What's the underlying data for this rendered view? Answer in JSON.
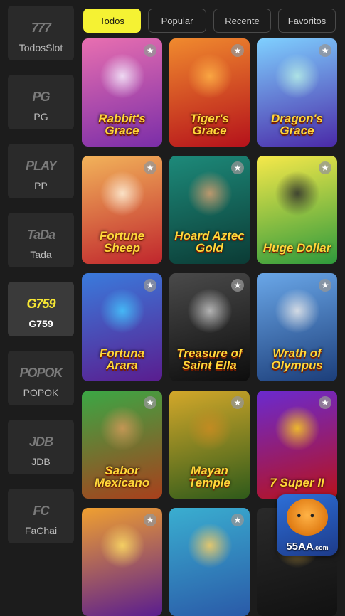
{
  "sidebar": {
    "items": [
      {
        "label": "TodosSlot",
        "logo": "777"
      },
      {
        "label": "PG",
        "logo": "PG"
      },
      {
        "label": "PP",
        "logo": "PLAY"
      },
      {
        "label": "Tada",
        "logo": "TaDa"
      },
      {
        "label": "G759",
        "logo": "G759"
      },
      {
        "label": "POPOK",
        "logo": "POPOK"
      },
      {
        "label": "JDB",
        "logo": "JDB"
      },
      {
        "label": "FaChai",
        "logo": "FC"
      }
    ],
    "active": "G759"
  },
  "tabs": [
    {
      "label": "Todos"
    },
    {
      "label": "Popular"
    },
    {
      "label": "Recente"
    },
    {
      "label": "Favoritos"
    }
  ],
  "games": [
    {
      "title": "Rabbit's Grace",
      "bg1": "#e86fb0",
      "bg2": "#7b2ea8",
      "art": "#f6f0ff"
    },
    {
      "title": "Tiger's Grace",
      "bg1": "#f08a2e",
      "bg2": "#b5121b",
      "art": "#ffb347"
    },
    {
      "title": "Dragon's Grace",
      "bg1": "#7fd0ff",
      "bg2": "#4a2aa8",
      "art": "#b8f0e6"
    },
    {
      "title": "Fortune Sheep",
      "bg1": "#f2b35a",
      "bg2": "#c0262d",
      "art": "#fff3dc"
    },
    {
      "title": "Hoard Aztec Gold",
      "bg1": "#1d8a7a",
      "bg2": "#0b3b35",
      "art": "#d8a070"
    },
    {
      "title": "Huge Dollar",
      "bg1": "#f7e94a",
      "bg2": "#2e9a3c",
      "art": "#2d2d2d"
    },
    {
      "title": "Fortuna Arara",
      "bg1": "#3a7bdc",
      "bg2": "#5a1d8f",
      "art": "#45c8ff"
    },
    {
      "title": "Treasure of Saint Ella",
      "bg1": "#4a4a4a",
      "bg2": "#0d0d0d",
      "art": "#c9c9c9"
    },
    {
      "title": "Wrath of Olympus",
      "bg1": "#6aa7e8",
      "bg2": "#1c3e7a",
      "art": "#eaeaea"
    },
    {
      "title": "Sabor Mexicano",
      "bg1": "#3aa845",
      "bg2": "#a8401c",
      "art": "#d59a5a"
    },
    {
      "title": "Mayan Temple",
      "bg1": "#d4a82a",
      "bg2": "#2f5a1a",
      "art": "#c98b22"
    },
    {
      "title": "7 Super II",
      "bg1": "#6a2ad0",
      "bg2": "#b8121c",
      "art": "#ffd21c"
    },
    {
      "title": "",
      "bg1": "#f0a030",
      "bg2": "#5a1d8f",
      "art": "#ffe066"
    },
    {
      "title": "",
      "bg1": "#3aaed0",
      "bg2": "#2a5aa8",
      "art": "#ffd060"
    },
    {
      "title": "",
      "bg1": "#2a2a2a",
      "bg2": "#111111",
      "art": "#c8a040"
    }
  ],
  "promo_badge": {
    "label": "55AA",
    "suffix": ".com"
  }
}
